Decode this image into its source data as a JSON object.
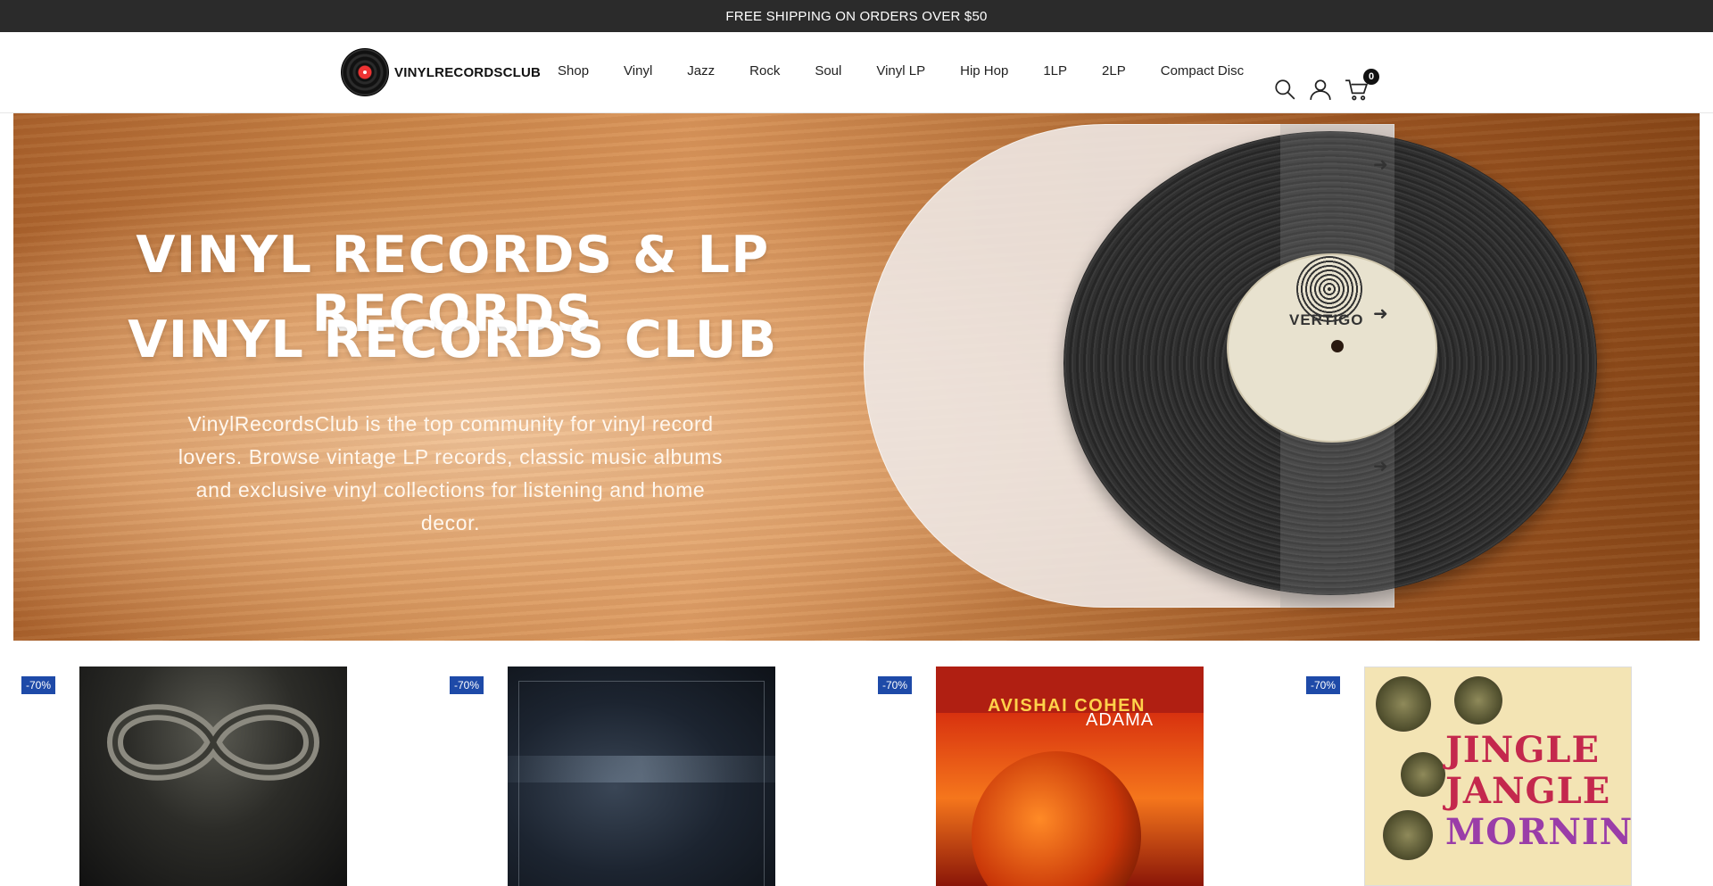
{
  "announcement": {
    "text": "FREE SHIPPING ON ORDERS OVER $50"
  },
  "header": {
    "logo_text": "VINYLRECORDSCLUB",
    "nav": [
      {
        "label": "Shop"
      },
      {
        "label": "Vinyl"
      },
      {
        "label": "Jazz"
      },
      {
        "label": "Rock"
      },
      {
        "label": "Soul"
      },
      {
        "label": "Vinyl LP"
      },
      {
        "label": "Hip Hop"
      },
      {
        "label": "1LP"
      },
      {
        "label": "2LP"
      },
      {
        "label": "Compact Disc"
      }
    ],
    "icons": {
      "search": "search-icon",
      "account": "user-icon",
      "cart": "cart-icon"
    },
    "cart_count": "0"
  },
  "hero": {
    "title_line1": "VINYL RECORDS & LP RECORDS",
    "title_line2": "VINYL RECORDS CLUB",
    "description": "VinylRecordsClub is the top community for vinyl record lovers. Browse vintage LP records, classic music albums and exclusive vinyl collections for listening and home decor.",
    "record_label_text": "VERTIGO"
  },
  "products": [
    {
      "badge": "-70%"
    },
    {
      "badge": "-70%"
    },
    {
      "badge": "-70%",
      "cover_artist": "AVISHAI COHEN",
      "cover_album": "ADAMA"
    },
    {
      "badge": "-70%",
      "cover_title_1": "JINGLE",
      "cover_title_2": "JANGLE",
      "cover_title_3": "MORNING"
    }
  ],
  "colors": {
    "announcement_bg": "#2b2b2b",
    "badge_bg": "#1e4aa8",
    "cart_count_bg": "#111111"
  }
}
